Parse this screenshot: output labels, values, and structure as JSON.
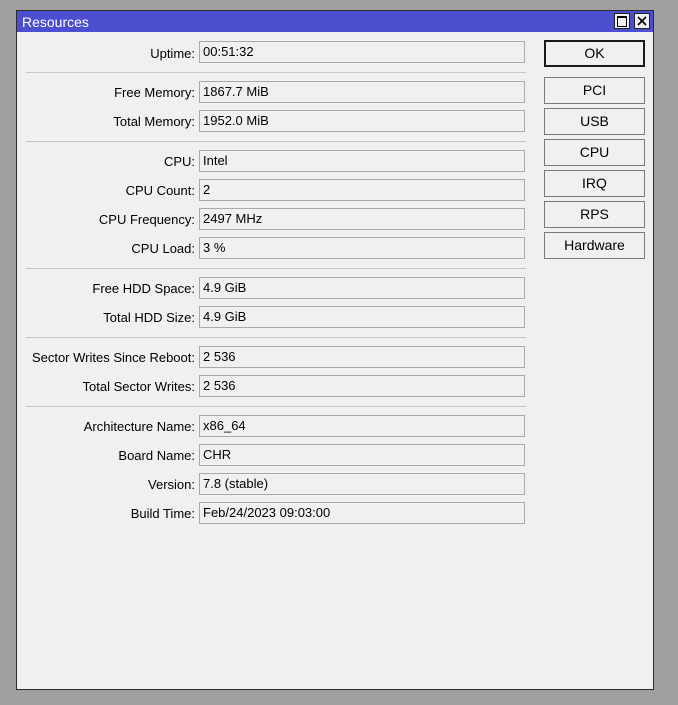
{
  "window": {
    "title": "Resources"
  },
  "fields": {
    "uptime": {
      "label": "Uptime:",
      "value": "00:51:32"
    },
    "free_memory": {
      "label": "Free Memory:",
      "value": "1867.7 MiB"
    },
    "total_memory": {
      "label": "Total Memory:",
      "value": "1952.0 MiB"
    },
    "cpu": {
      "label": "CPU:",
      "value": "Intel"
    },
    "cpu_count": {
      "label": "CPU Count:",
      "value": "2"
    },
    "cpu_frequency": {
      "label": "CPU Frequency:",
      "value": "2497 MHz"
    },
    "cpu_load": {
      "label": "CPU Load:",
      "value": "3 %"
    },
    "free_hdd": {
      "label": "Free HDD Space:",
      "value": "4.9 GiB"
    },
    "total_hdd": {
      "label": "Total HDD Size:",
      "value": "4.9 GiB"
    },
    "sector_writes": {
      "label": "Sector Writes Since Reboot:",
      "value": "2 536"
    },
    "total_sector_writes": {
      "label": "Total Sector Writes:",
      "value": "2 536"
    },
    "architecture": {
      "label": "Architecture Name:",
      "value": "x86_64"
    },
    "board_name": {
      "label": "Board Name:",
      "value": "CHR"
    },
    "version": {
      "label": "Version:",
      "value": "7.8 (stable)"
    },
    "build_time": {
      "label": "Build Time:",
      "value": "Feb/24/2023 09:03:00"
    }
  },
  "buttons": {
    "ok": "OK",
    "pci": "PCI",
    "usb": "USB",
    "cpu": "CPU",
    "irq": "IRQ",
    "rps": "RPS",
    "hardware": "Hardware"
  }
}
